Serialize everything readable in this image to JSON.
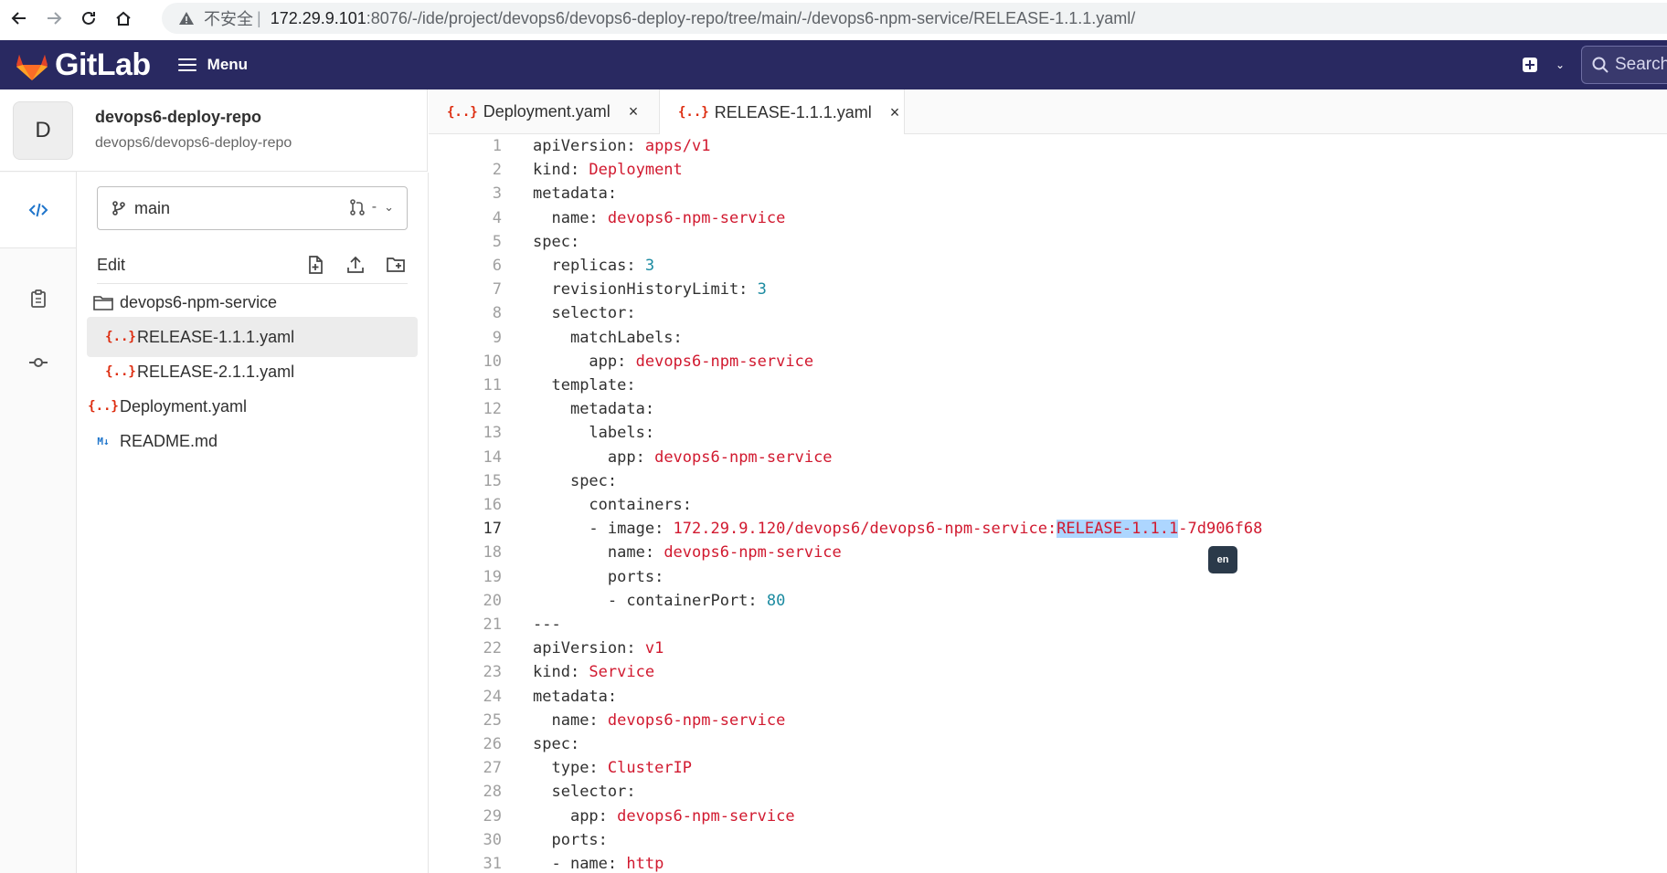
{
  "browser": {
    "insecure_label": "不安全",
    "separator": "|",
    "url_host": "172.29.9.101",
    "url_path": ":8076/-/ide/project/devops6/devops6-deploy-repo/tree/main/-/devops6-npm-service/RELEASE-1.1.1.yaml/"
  },
  "header": {
    "logo_text": "GitLab",
    "menu_label": "Menu",
    "search_placeholder": "Search",
    "brand_color": "#292961"
  },
  "project": {
    "avatar_letter": "D",
    "name": "devops6-deploy-repo",
    "path": "devops6/devops6-deploy-repo"
  },
  "branch": {
    "name": "main",
    "mr_label": "-"
  },
  "tree": {
    "edit_label": "Edit",
    "items": [
      {
        "label": "devops6-npm-service",
        "icon": "folder-icon"
      },
      {
        "label": "RELEASE-1.1.1.yaml",
        "icon": "yaml-file-icon",
        "selected": true
      },
      {
        "label": "RELEASE-2.1.1.yaml",
        "icon": "yaml-file-icon"
      },
      {
        "label": "Deployment.yaml",
        "icon": "yaml-file-icon"
      },
      {
        "label": "README.md",
        "icon": "markdown-file-icon"
      }
    ],
    "file_icon_glyph": "{..}",
    "md_icon_glyph": "M↓"
  },
  "tabs": [
    {
      "label": "Deployment.yaml",
      "close": "×"
    },
    {
      "label": "RELEASE-1.1.1.yaml",
      "close": "×",
      "active": true
    }
  ],
  "editor": {
    "current_line": 17,
    "lines": [
      {
        "n": "1",
        "indent": "",
        "key": "apiVersion:",
        "val": " apps/v1",
        "type": "v"
      },
      {
        "n": "2",
        "indent": "",
        "key": "kind:",
        "val": " Deployment",
        "type": "v"
      },
      {
        "n": "3",
        "indent": "",
        "key": "metadata:",
        "val": "",
        "type": "v"
      },
      {
        "n": "4",
        "indent": "  ",
        "key": "name:",
        "val": " devops6-npm-service",
        "type": "v"
      },
      {
        "n": "5",
        "indent": "",
        "key": "spec:",
        "val": "",
        "type": "v"
      },
      {
        "n": "6",
        "indent": "  ",
        "key": "replicas:",
        "val": " 3",
        "type": "n"
      },
      {
        "n": "7",
        "indent": "  ",
        "key": "revisionHistoryLimit:",
        "val": " 3",
        "type": "n"
      },
      {
        "n": "8",
        "indent": "  ",
        "key": "selector:",
        "val": "",
        "type": "v"
      },
      {
        "n": "9",
        "indent": "    ",
        "key": "matchLabels:",
        "val": "",
        "type": "v"
      },
      {
        "n": "10",
        "indent": "      ",
        "key": "app:",
        "val": " devops6-npm-service",
        "type": "v"
      },
      {
        "n": "11",
        "indent": "  ",
        "key": "template:",
        "val": "",
        "type": "v"
      },
      {
        "n": "12",
        "indent": "    ",
        "key": "metadata:",
        "val": "",
        "type": "v"
      },
      {
        "n": "13",
        "indent": "      ",
        "key": "labels:",
        "val": "",
        "type": "v"
      },
      {
        "n": "14",
        "indent": "        ",
        "key": "app:",
        "val": " devops6-npm-service",
        "type": "v"
      },
      {
        "n": "15",
        "indent": "    ",
        "key": "spec:",
        "val": "",
        "type": "v"
      },
      {
        "n": "16",
        "indent": "      ",
        "key": "containers:",
        "val": "",
        "type": "v"
      },
      {
        "n": "17",
        "indent": "      ",
        "key": "- image:",
        "val": " 172.29.9.120/devops6/devops6-npm-service:",
        "type": "v",
        "hl": "RELEASE-1.1.1",
        "tail": "-7d906f68"
      },
      {
        "n": "18",
        "indent": "        ",
        "key": "name:",
        "val": " devops6-npm-service",
        "type": "v"
      },
      {
        "n": "19",
        "indent": "        ",
        "key": "ports:",
        "val": "",
        "type": "v"
      },
      {
        "n": "20",
        "indent": "        ",
        "key": "- containerPort:",
        "val": " 80",
        "type": "n"
      },
      {
        "n": "21",
        "indent": "",
        "key": "---",
        "val": "",
        "type": "v"
      },
      {
        "n": "22",
        "indent": "",
        "key": "apiVersion:",
        "val": " v1",
        "type": "v"
      },
      {
        "n": "23",
        "indent": "",
        "key": "kind:",
        "val": " Service",
        "type": "v"
      },
      {
        "n": "24",
        "indent": "",
        "key": "metadata:",
        "val": "",
        "type": "v"
      },
      {
        "n": "25",
        "indent": "  ",
        "key": "name:",
        "val": " devops6-npm-service",
        "type": "v"
      },
      {
        "n": "26",
        "indent": "",
        "key": "spec:",
        "val": "",
        "type": "v"
      },
      {
        "n": "27",
        "indent": "  ",
        "key": "type:",
        "val": " ClusterIP",
        "type": "v"
      },
      {
        "n": "28",
        "indent": "  ",
        "key": "selector:",
        "val": "",
        "type": "v"
      },
      {
        "n": "29",
        "indent": "    ",
        "key": "app:",
        "val": " devops6-npm-service",
        "type": "v"
      },
      {
        "n": "30",
        "indent": "  ",
        "key": "ports:",
        "val": "",
        "type": "v"
      },
      {
        "n": "31",
        "indent": "  ",
        "key": "- name:",
        "val": " http",
        "type": "v"
      }
    ]
  },
  "ime": {
    "label": "en"
  }
}
